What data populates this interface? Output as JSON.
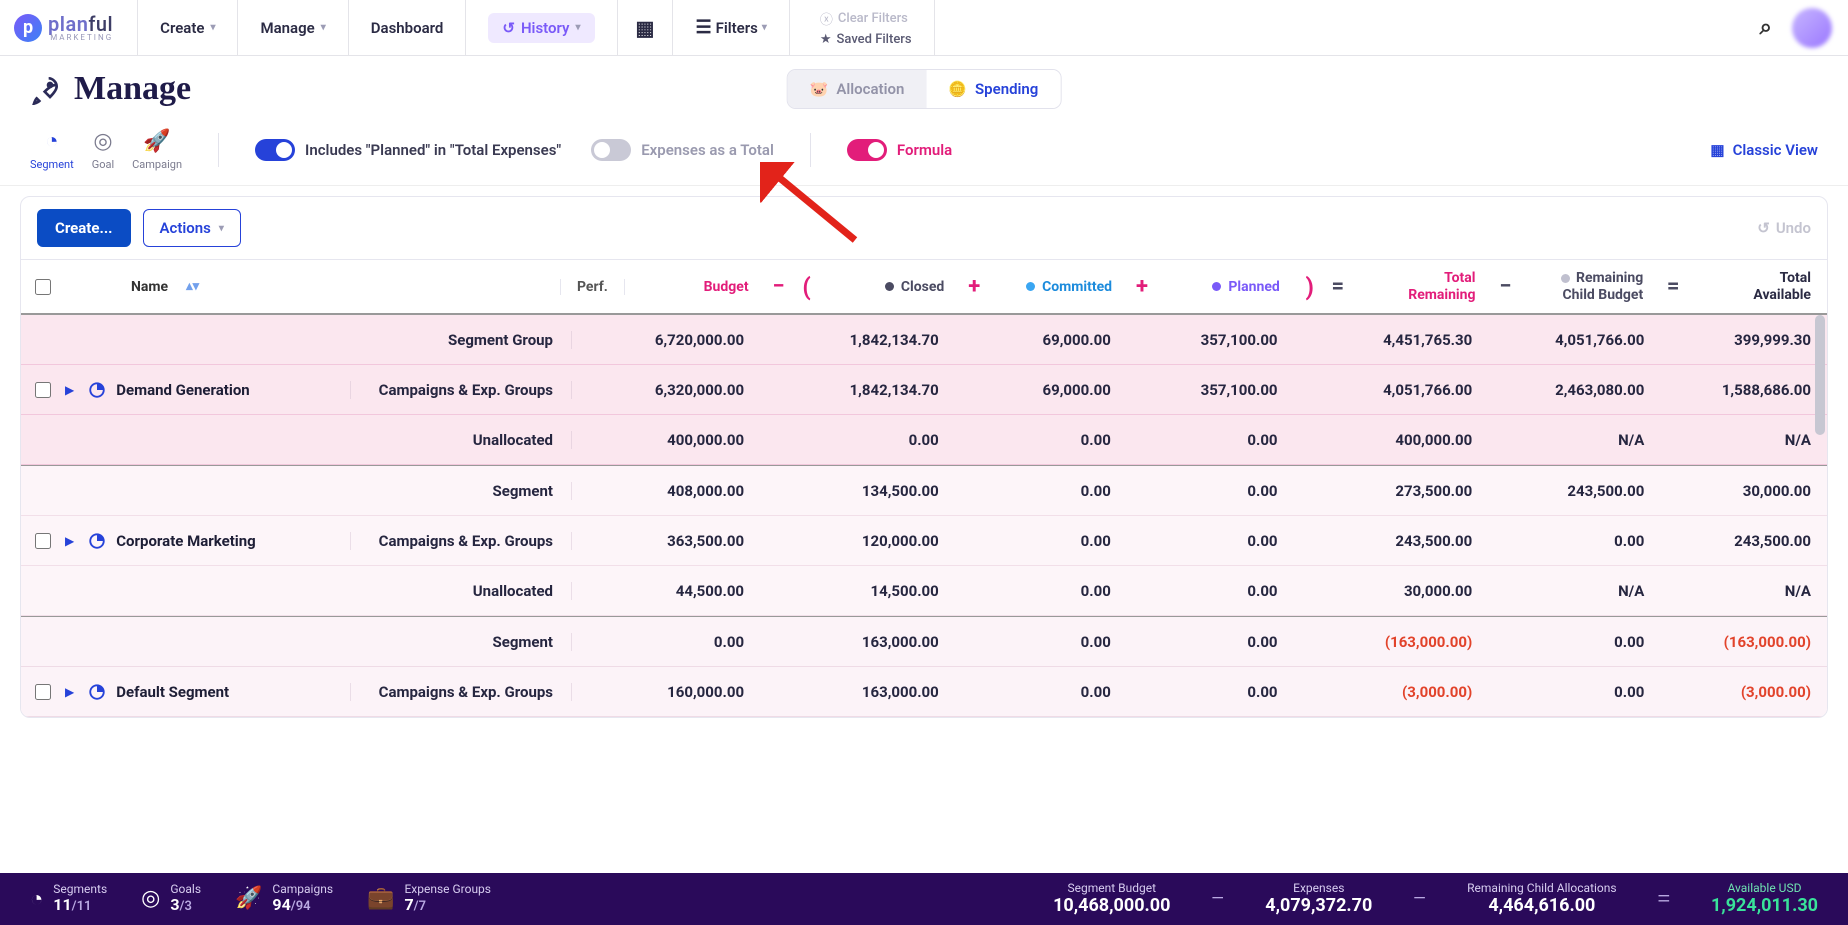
{
  "nav": {
    "brand_a": "plan",
    "brand_b": "ful",
    "brand_sub": "MARKETING",
    "create": "Create",
    "manage": "Manage",
    "dashboard": "Dashboard",
    "history": "History",
    "filters": "Filters",
    "clear_filters": "Clear Filters",
    "saved_filters": "Saved Filters"
  },
  "page": {
    "title": "Manage"
  },
  "segmented": {
    "allocation": "Allocation",
    "spending": "Spending"
  },
  "view_tabs": {
    "segment": "Segment",
    "goal": "Goal",
    "campaign": "Campaign"
  },
  "toggles": {
    "includes_planned": "Includes \"Planned\" in \"Total Expenses\"",
    "expenses_total": "Expenses as a Total",
    "formula": "Formula"
  },
  "classic_view": "Classic View",
  "buttons": {
    "create": "Create...",
    "actions": "Actions",
    "undo": "Undo"
  },
  "headers": {
    "name": "Name",
    "perf": "Perf.",
    "budget": "Budget",
    "closed": "Closed",
    "committed": "Committed",
    "planned": "Planned",
    "total_remaining_1": "Total",
    "total_remaining_2": "Remaining",
    "child_1": "Remaining",
    "child_2": "Child Budget",
    "avail_1": "Total",
    "avail_2": "Available"
  },
  "row_labels": {
    "segment_group": "Segment Group",
    "segment": "Segment",
    "campaigns": "Campaigns & Exp. Groups",
    "unallocated": "Unallocated"
  },
  "segments": [
    {
      "name": "Demand Generation",
      "tint": "tint-strong",
      "sub": [
        {
          "label": "segment_group",
          "budget": "6,720,000.00",
          "closed": "1,842,134.70",
          "committed": "69,000.00",
          "planned": "357,100.00",
          "remaining": "4,451,765.30",
          "child": "4,051,766.00",
          "avail": "399,999.30"
        },
        {
          "label": "campaigns",
          "budget": "6,320,000.00",
          "closed": "1,842,134.70",
          "committed": "69,000.00",
          "planned": "357,100.00",
          "remaining": "4,051,766.00",
          "child": "2,463,080.00",
          "avail": "1,588,686.00"
        },
        {
          "label": "unallocated",
          "budget": "400,000.00",
          "closed": "0.00",
          "committed": "0.00",
          "planned": "0.00",
          "remaining": "400,000.00",
          "child": "N/A",
          "avail": "N/A"
        }
      ]
    },
    {
      "name": "Corporate Marketing",
      "tint": "tint-weak",
      "sub": [
        {
          "label": "segment",
          "budget": "408,000.00",
          "closed": "134,500.00",
          "committed": "0.00",
          "planned": "0.00",
          "remaining": "273,500.00",
          "child": "243,500.00",
          "avail": "30,000.00"
        },
        {
          "label": "campaigns",
          "budget": "363,500.00",
          "closed": "120,000.00",
          "committed": "0.00",
          "planned": "0.00",
          "remaining": "243,500.00",
          "child": "0.00",
          "avail": "243,500.00"
        },
        {
          "label": "unallocated",
          "budget": "44,500.00",
          "closed": "14,500.00",
          "committed": "0.00",
          "planned": "0.00",
          "remaining": "30,000.00",
          "child": "N/A",
          "avail": "N/A"
        }
      ]
    },
    {
      "name": "Default Segment",
      "tint": "tint-weak2",
      "sub": [
        {
          "label": "segment",
          "budget": "0.00",
          "closed": "163,000.00",
          "committed": "0.00",
          "planned": "0.00",
          "remaining": "(163,000.00)",
          "rem_neg": true,
          "child": "0.00",
          "avail": "(163,000.00)",
          "avail_neg": true
        },
        {
          "label": "campaigns",
          "budget": "160,000.00",
          "closed": "163,000.00",
          "committed": "0.00",
          "planned": "0.00",
          "remaining": "(3,000.00)",
          "rem_neg": true,
          "child": "0.00",
          "avail": "(3,000.00)",
          "avail_neg": true
        }
      ]
    }
  ],
  "footer": {
    "segments_label": "Segments",
    "segments_v": "11",
    "segments_t": "/11",
    "goals_label": "Goals",
    "goals_v": "3",
    "goals_t": "/3",
    "campaigns_label": "Campaigns",
    "campaigns_v": "94",
    "campaigns_t": "/94",
    "expg_label": "Expense Groups",
    "expg_v": "7",
    "expg_t": "/7",
    "seg_budget_label": "Segment Budget",
    "seg_budget": "10,468,000.00",
    "expenses_label": "Expenses",
    "expenses": "4,079,372.70",
    "remchild_label": "Remaining Child Allocations",
    "remchild": "4,464,616.00",
    "avail_label": "Available USD",
    "avail": "1,924,011.30"
  }
}
